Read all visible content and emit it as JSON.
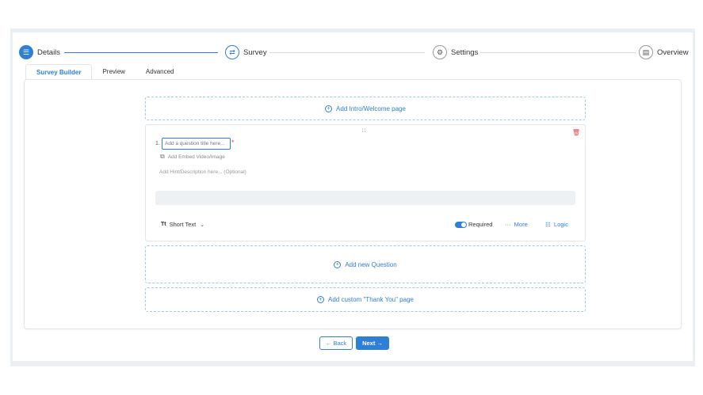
{
  "stepper": {
    "steps": [
      {
        "label": "Details",
        "icon": "list-icon",
        "state": "active"
      },
      {
        "label": "Survey",
        "icon": "survey-icon",
        "state": "current"
      },
      {
        "label": "Settings",
        "icon": "gear-icon",
        "state": "todo"
      },
      {
        "label": "Overview",
        "icon": "clipboard-icon",
        "state": "todo"
      }
    ]
  },
  "tabs": [
    {
      "label": "Survey Builder",
      "active": true
    },
    {
      "label": "Preview",
      "active": false
    },
    {
      "label": "Advanced",
      "active": false
    }
  ],
  "builder": {
    "add_intro_label": "Add Intro/Welcome page",
    "question": {
      "number": "1.",
      "title_placeholder": "Add a question title here...",
      "required_mark": "*",
      "embed_label": "Add Embed Video/Image",
      "hint_placeholder": "Add Hint/Description here... (Optional)",
      "type_label": "Short Text",
      "type_icon_text": "Tt",
      "required_label": "Required",
      "required_on": true,
      "more_label": "More",
      "more_icon_text": "···",
      "logic_label": "Logic",
      "logic_icon_text": "☷",
      "drag_handle_text": "∷",
      "trash_icon_text": "🗑"
    },
    "add_question_label": "Add new Question",
    "add_thankyou_label": "Add custom \"Thank You\" page"
  },
  "footer": {
    "back_label": "Back",
    "back_icon_text": "←",
    "next_label": "Next",
    "next_icon_text": "→"
  },
  "colors": {
    "accent": "#2f7fd6",
    "danger": "#e04848",
    "frame_bg": "#eaeff4",
    "dashed_border": "#9ccbe8"
  }
}
